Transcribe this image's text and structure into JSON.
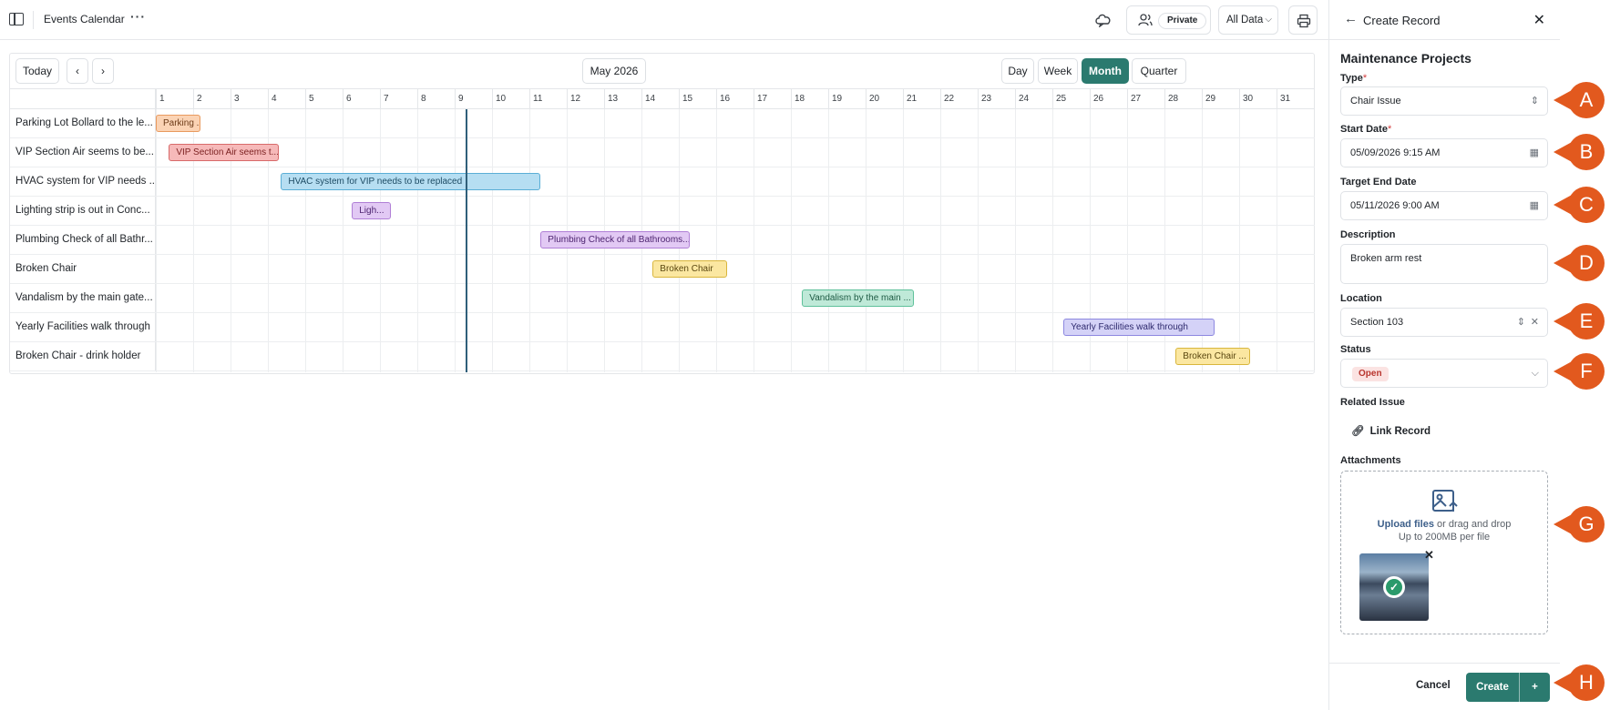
{
  "topbar": {
    "title": "Events Calendar",
    "more": "···",
    "privacy_label": "Private",
    "data_filter": "All Data"
  },
  "calendar": {
    "today": "Today",
    "month_label": "May 2026",
    "views": [
      "Day",
      "Week",
      "Month",
      "Quarter"
    ],
    "active_view": "Month",
    "days": [
      "1",
      "2",
      "3",
      "4",
      "5",
      "6",
      "7",
      "8",
      "9",
      "10",
      "11",
      "12",
      "13",
      "14",
      "15",
      "16",
      "17",
      "18",
      "19",
      "20",
      "21",
      "22",
      "23",
      "24",
      "25",
      "26",
      "27",
      "28",
      "29",
      "30",
      "31"
    ],
    "rows": [
      {
        "label": "Parking Lot Bollard to the le...",
        "bar": "Parking ...",
        "start": 1,
        "end": 2.2,
        "bg": "#fbd3b4",
        "bd": "#e89a5f",
        "fg": "#6b3a17"
      },
      {
        "label": "VIP Section Air seems to be...",
        "bar": "VIP Section Air seems t...",
        "start": 1.35,
        "end": 4.3,
        "bg": "#f6b9b9",
        "bd": "#d86a6a",
        "fg": "#7a1f1f"
      },
      {
        "label": "HVAC system for VIP needs ...",
        "bar": "HVAC system for VIP needs to be replaced",
        "start": 4.35,
        "end": 11.3,
        "bg": "#b6def2",
        "bd": "#5aaed6",
        "fg": "#1c4a63"
      },
      {
        "label": "Lighting strip is out in Conc...",
        "bar": "Ligh...",
        "start": 6.25,
        "end": 7.3,
        "bg": "#e2c9f4",
        "bd": "#b07fd6",
        "fg": "#4d2470"
      },
      {
        "label": "Plumbing Check of all Bathr...",
        "bar": "Plumbing Check of all Bathrooms...",
        "start": 11.3,
        "end": 15.3,
        "bg": "#e2c9f4",
        "bd": "#b07fd6",
        "fg": "#4d2470"
      },
      {
        "label": "Broken Chair",
        "bar": "Broken Chair",
        "start": 14.3,
        "end": 16.3,
        "bg": "#fbe7a1",
        "bd": "#d9b63d",
        "fg": "#5a4710"
      },
      {
        "label": "Vandalism by the main gate...",
        "bar": "Vandalism by the main ...",
        "start": 18.3,
        "end": 21.3,
        "bg": "#bfe9d8",
        "bd": "#5ec19a",
        "fg": "#1d5a43"
      },
      {
        "label": "Yearly Facilities walk through",
        "bar": "Yearly Facilities walk through",
        "start": 25.3,
        "end": 29.35,
        "bg": "#d4d2f7",
        "bd": "#8d88e0",
        "fg": "#2e2a6e"
      },
      {
        "label": "Broken Chair - drink holder",
        "bar": "Broken Chair ...",
        "start": 28.3,
        "end": 30.3,
        "bg": "#fbe7a1",
        "bd": "#d9b63d",
        "fg": "#5a4710"
      }
    ],
    "today_day": 9.3
  },
  "panel": {
    "header_title": "Create Record",
    "section_title": "Maintenance Projects",
    "type_label": "Type",
    "type_value": "Chair Issue",
    "start_label": "Start Date",
    "start_value": "05/09/2026 9:15 AM",
    "end_label": "Target End Date",
    "end_value": "05/11/2026 9:00 AM",
    "desc_label": "Description",
    "desc_value": "Broken arm rest",
    "location_label": "Location",
    "location_value": "Section 103",
    "status_label": "Status",
    "status_value": "Open",
    "related_label": "Related Issue",
    "link_record": "Link Record",
    "attachments_label": "Attachments",
    "upload_strong": "Upload files",
    "upload_rest": " or drag and drop",
    "upload_limit": "Up to 200MB per file",
    "cancel": "Cancel",
    "create": "Create",
    "create_plus": "+",
    "required_mark": "*"
  },
  "markers": [
    "A",
    "B",
    "C",
    "D",
    "E",
    "F",
    "G",
    "H"
  ],
  "colors": {
    "accent": "#2b7a6f",
    "marker": "#e2591e"
  }
}
